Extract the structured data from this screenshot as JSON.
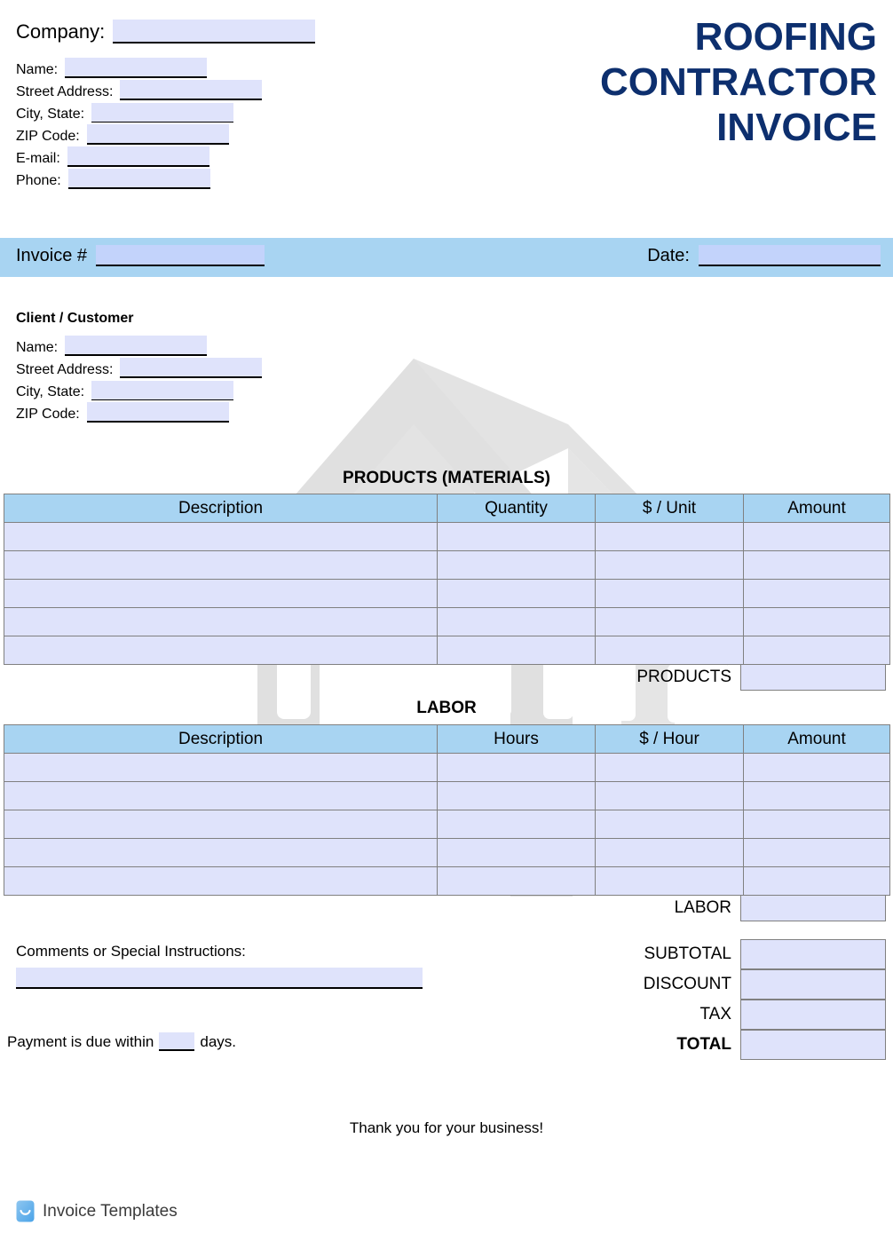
{
  "document": {
    "title_lines": [
      "ROOFING",
      "CONTRACTOR",
      "INVOICE"
    ],
    "title_color": "#0d2f6e",
    "accent_bar_color": "#a8d4f2",
    "field_fill_color": "#dfe3fb"
  },
  "company": {
    "company_label": "Company:",
    "rows": [
      {
        "label": "Name:",
        "field_width": 160
      },
      {
        "label": "Street Address:",
        "field_width": 160
      },
      {
        "label": "City, State:",
        "field_width": 160
      },
      {
        "label": "ZIP Code:",
        "field_width": 160
      },
      {
        "label": "E-mail:",
        "field_width": 160
      },
      {
        "label": "Phone:",
        "field_width": 160
      }
    ]
  },
  "invoice_bar": {
    "invoice_label": "Invoice #",
    "invoice_value": "",
    "date_label": "Date:",
    "date_value": ""
  },
  "client": {
    "heading": "Client / Customer",
    "rows": [
      {
        "label": "Name:"
      },
      {
        "label": "Street Address:"
      },
      {
        "label": "City, State:"
      },
      {
        "label": "ZIP Code:"
      }
    ]
  },
  "products": {
    "section_title": "PRODUCTS (MATERIALS)",
    "headers": [
      "Description",
      "Quantity",
      "$ / Unit",
      "Amount"
    ],
    "rows": [
      [
        "",
        "",
        "",
        ""
      ],
      [
        "",
        "",
        "",
        ""
      ],
      [
        "",
        "",
        "",
        ""
      ],
      [
        "",
        "",
        "",
        ""
      ],
      [
        "",
        "",
        "",
        ""
      ]
    ],
    "total_label": "PRODUCTS",
    "total_value": ""
  },
  "labor": {
    "section_title": "LABOR",
    "headers": [
      "Description",
      "Hours",
      "$ / Hour",
      "Amount"
    ],
    "rows": [
      [
        "",
        "",
        "",
        ""
      ],
      [
        "",
        "",
        "",
        ""
      ],
      [
        "",
        "",
        "",
        ""
      ],
      [
        "",
        "",
        "",
        ""
      ],
      [
        "",
        "",
        "",
        ""
      ]
    ],
    "total_label": "LABOR",
    "total_value": ""
  },
  "totals": [
    {
      "label": "SUBTOTAL",
      "value": "",
      "bold": false
    },
    {
      "label": "DISCOUNT",
      "value": "",
      "bold": false
    },
    {
      "label": "TAX",
      "value": "",
      "bold": false
    },
    {
      "label": "TOTAL",
      "value": "",
      "bold": true
    }
  ],
  "comments": {
    "label": "Comments or Special Instructions:",
    "value": ""
  },
  "payment_terms": {
    "prefix": "Payment is due within",
    "days": "",
    "suffix": "days."
  },
  "footer": {
    "thank_you": "Thank you for your business!",
    "brand_name": "Invoice Templates",
    "brand_icon": "smile-badge-icon"
  }
}
